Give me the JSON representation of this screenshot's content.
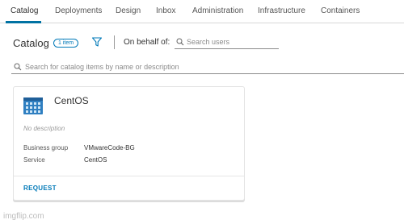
{
  "tabs": [
    {
      "label": "Catalog"
    },
    {
      "label": "Deployments"
    },
    {
      "label": "Design"
    },
    {
      "label": "Inbox"
    },
    {
      "label": "Administration"
    },
    {
      "label": "Infrastructure"
    },
    {
      "label": "Containers"
    }
  ],
  "active_tab": "Catalog",
  "header": {
    "title": "Catalog",
    "count_badge": "1 item",
    "on_behalf_label": "On behalf of:",
    "users_search_placeholder": "Search users",
    "users_search_value": ""
  },
  "catalog_search": {
    "placeholder": "Search for catalog items by name or description",
    "value": ""
  },
  "card": {
    "title": "CentOS",
    "description": "No description",
    "properties": [
      {
        "label": "Business group",
        "value": "VMwareCode-BG"
      },
      {
        "label": "Service",
        "value": "CentOS"
      }
    ],
    "request_label": "REQUEST"
  },
  "watermark": "imgflip.com",
  "colors": {
    "accent": "#0079b8",
    "active_tab_underline": "#0072a3"
  },
  "icons": [
    "filter-icon",
    "search-icon",
    "centos-blueprint-icon"
  ]
}
